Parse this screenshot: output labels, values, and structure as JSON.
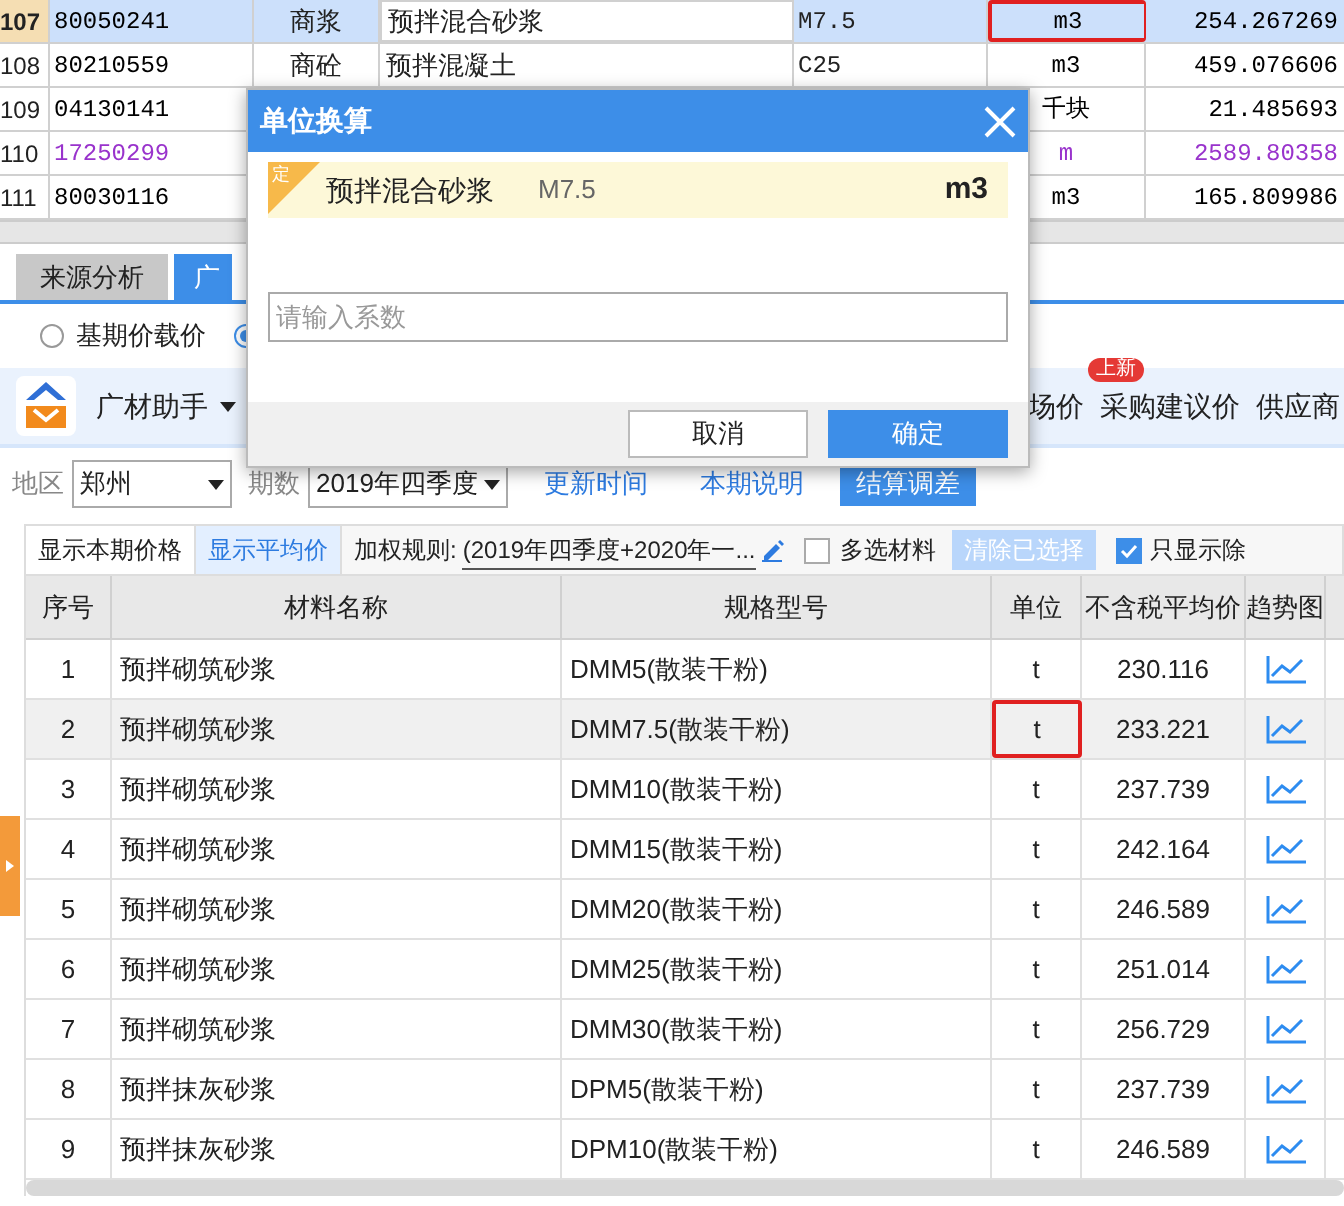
{
  "top_table": {
    "rows": [
      {
        "row_number": "107",
        "code": "80050241",
        "type": "商浆",
        "name": "预拌混合砂浆",
        "spec": "M7.5",
        "unit": "m3",
        "price": "254.267269",
        "selected": true,
        "marked": true,
        "color": "#000000"
      },
      {
        "row_number": "108",
        "code": "80210559",
        "type": "商砼",
        "name": "预拌混凝土",
        "spec": "C25",
        "unit": "m3",
        "price": "459.076606",
        "selected": false,
        "marked": false,
        "color": "#000000"
      },
      {
        "row_number": "109",
        "code": "04130141",
        "unit": "千块",
        "price": "21.485693",
        "selected": false,
        "marked": false,
        "color": "#000000"
      },
      {
        "row_number": "110",
        "code": "17250299",
        "unit": "m",
        "price": "2589.80358",
        "selected": false,
        "marked": false,
        "color": "#9933cc"
      },
      {
        "row_number": "111",
        "code": "80030116",
        "unit": "m3",
        "price": "165.809986",
        "selected": false,
        "marked": false,
        "color": "#000000"
      }
    ]
  },
  "tabs": [
    {
      "label": "来源分析",
      "selected": false
    },
    {
      "label": "广",
      "selected": true
    }
  ],
  "price_options": [
    {
      "label": "基期价载价",
      "selected": false
    },
    {
      "selected": true
    }
  ],
  "toolbar": {
    "title": "广材助手",
    "items": [
      {
        "label": "场价"
      },
      {
        "label": "采购建议价",
        "badge": "上新"
      },
      {
        "label": "供应商"
      }
    ]
  },
  "filters": {
    "region_label": "地区",
    "region": "郑州",
    "period_label": "期数",
    "period": "2019年四季度",
    "buttons": [
      {
        "label": "更新时间",
        "kind": "link"
      },
      {
        "label": "本期说明",
        "kind": "link"
      },
      {
        "label": "结算调差",
        "kind": "primary"
      }
    ]
  },
  "view_options": {
    "modes": [
      {
        "label": "显示本期价格",
        "selected": false
      },
      {
        "label": "显示平均价",
        "selected": true
      }
    ],
    "rule_label": "加权规则:",
    "rule_value": "(2019年四季度+2020年一...",
    "multi_select": {
      "label": "多选材料",
      "checked": false
    },
    "clear_button": {
      "label": "清除已选择",
      "disabled": true
    },
    "only_show": {
      "label": "只显示除",
      "checked": true
    }
  },
  "table": {
    "columns": [
      "序号",
      "材料名称",
      "规格型号",
      "单位",
      "不含税平均价",
      "趋势图"
    ],
    "rows": [
      {
        "index": "1",
        "name": "预拌砌筑砂浆",
        "spec": "DMM5(散装干粉)",
        "unit": "t",
        "price": "230.116",
        "selected": false,
        "marked": false
      },
      {
        "index": "2",
        "name": "预拌砌筑砂浆",
        "spec": "DMM7.5(散装干粉)",
        "unit": "t",
        "price": "233.221",
        "selected": true,
        "marked": true
      },
      {
        "index": "3",
        "name": "预拌砌筑砂浆",
        "spec": "DMM10(散装干粉)",
        "unit": "t",
        "price": "237.739",
        "selected": false,
        "marked": false
      },
      {
        "index": "4",
        "name": "预拌砌筑砂浆",
        "spec": "DMM15(散装干粉)",
        "unit": "t",
        "price": "242.164",
        "selected": false,
        "marked": false
      },
      {
        "index": "5",
        "name": "预拌砌筑砂浆",
        "spec": "DMM20(散装干粉)",
        "unit": "t",
        "price": "246.589",
        "selected": false,
        "marked": false
      },
      {
        "index": "6",
        "name": "预拌砌筑砂浆",
        "spec": "DMM25(散装干粉)",
        "unit": "t",
        "price": "251.014",
        "selected": false,
        "marked": false
      },
      {
        "index": "7",
        "name": "预拌砌筑砂浆",
        "spec": "DMM30(散装干粉)",
        "unit": "t",
        "price": "256.729",
        "selected": false,
        "marked": false
      },
      {
        "index": "8",
        "name": "预拌抹灰砂浆",
        "spec": "DPM5(散装干粉)",
        "unit": "t",
        "price": "237.739",
        "selected": false,
        "marked": false
      },
      {
        "index": "9",
        "name": "预拌抹灰砂浆",
        "spec": "DPM10(散装干粉)",
        "unit": "t",
        "price": "246.589",
        "selected": false,
        "marked": false
      }
    ]
  },
  "dialog": {
    "title": "单位换算",
    "item": {
      "tag": "定",
      "name": "预拌混合砂浆",
      "spec": "M7.5",
      "unit": "m3"
    },
    "input": {
      "placeholder": "请输入系数"
    },
    "buttons": [
      {
        "label": "取消",
        "kind": "secondary"
      },
      {
        "label": "确定",
        "kind": "primary"
      }
    ]
  }
}
